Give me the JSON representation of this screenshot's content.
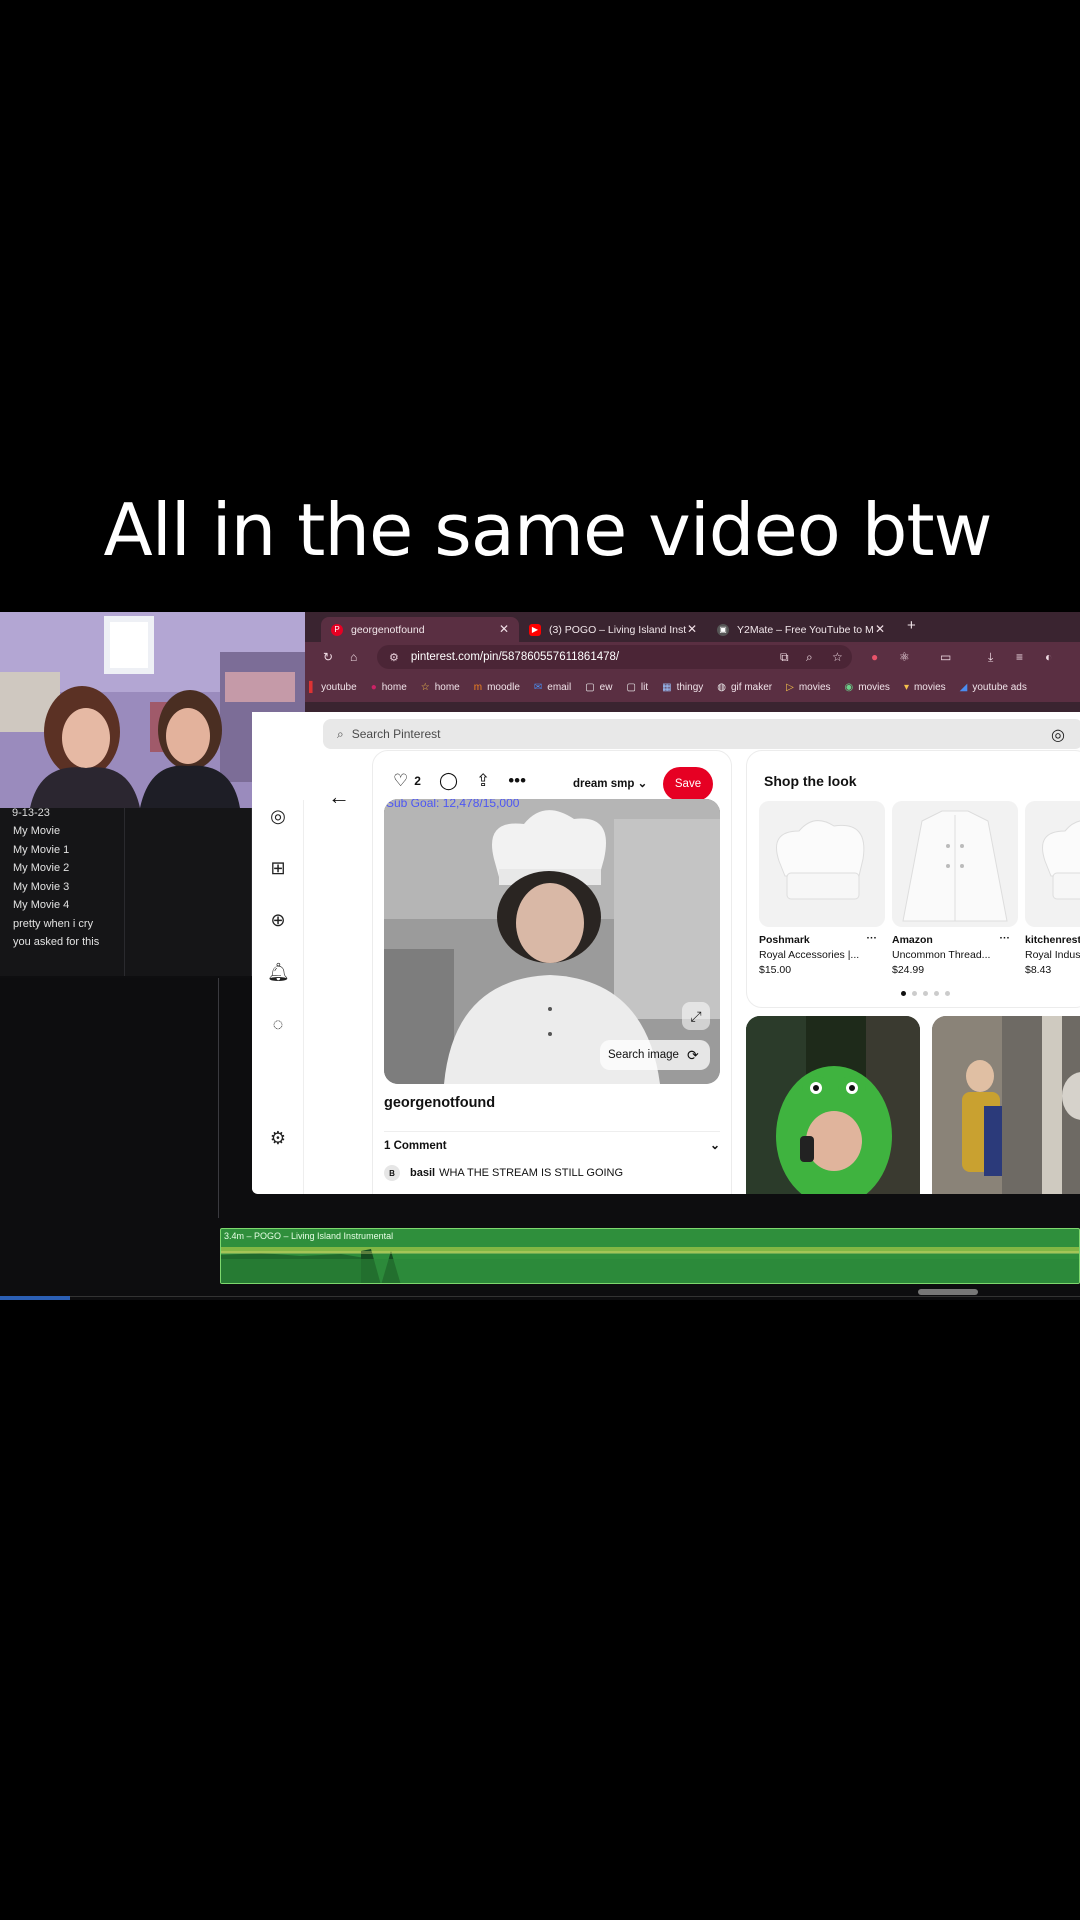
{
  "caption": "All in the same video btw",
  "editor": {
    "cut_label": "9-13-23",
    "movies": [
      "My Movie",
      "My Movie 1",
      "My Movie 2",
      "My Movie 3",
      "My Movie 4",
      "pretty when i cry",
      "you asked for this"
    ],
    "audio_track_label": "3.4m – POGO – Living Island Instrumental"
  },
  "browser": {
    "tabs": [
      {
        "label": "georgenotfound",
        "active": true,
        "color": "#e60023"
      },
      {
        "label": "(3) POGO – Living Island Inst",
        "active": false,
        "color": "#ff0000"
      },
      {
        "label": "Y2Mate – Free YouTube to M",
        "active": false,
        "color": "#555555"
      }
    ],
    "new_tab": "+",
    "url": "pinterest.com/pin/587860557611861478/",
    "bookmarks": [
      "youtube",
      "home",
      "home",
      "moodle",
      "email",
      "ew",
      "lit",
      "thingy",
      "gif maker",
      "movies",
      "movies",
      "movies",
      "youtube ads"
    ]
  },
  "pinterest": {
    "search_placeholder": "Search Pinterest",
    "like_count": "2",
    "board": "dream smp",
    "save_label": "Save",
    "sub_goal_overlay": "Sub Goal: 12,478/15,000",
    "search_image_label": "Search image",
    "pin_user": "georgenotfound",
    "comments_header": "1 Comment",
    "comment": {
      "avatar": "B",
      "user": "basil",
      "text": "WHA THE STREAM IS STILL GOING"
    },
    "shop": {
      "title": "Shop the look",
      "products": [
        {
          "store": "Poshmark",
          "name": "Royal Accessories |...",
          "price": "$15.00"
        },
        {
          "store": "Amazon",
          "name": "Uncommon Thread...",
          "price": "$24.99"
        },
        {
          "store": "kitchenrest",
          "name": "Royal Indus",
          "price": "$8.43"
        }
      ]
    }
  },
  "colors": {
    "pinterest_red": "#e60023",
    "browser_theme": "#5a2f42",
    "audio_track": "#2f8f3c"
  }
}
